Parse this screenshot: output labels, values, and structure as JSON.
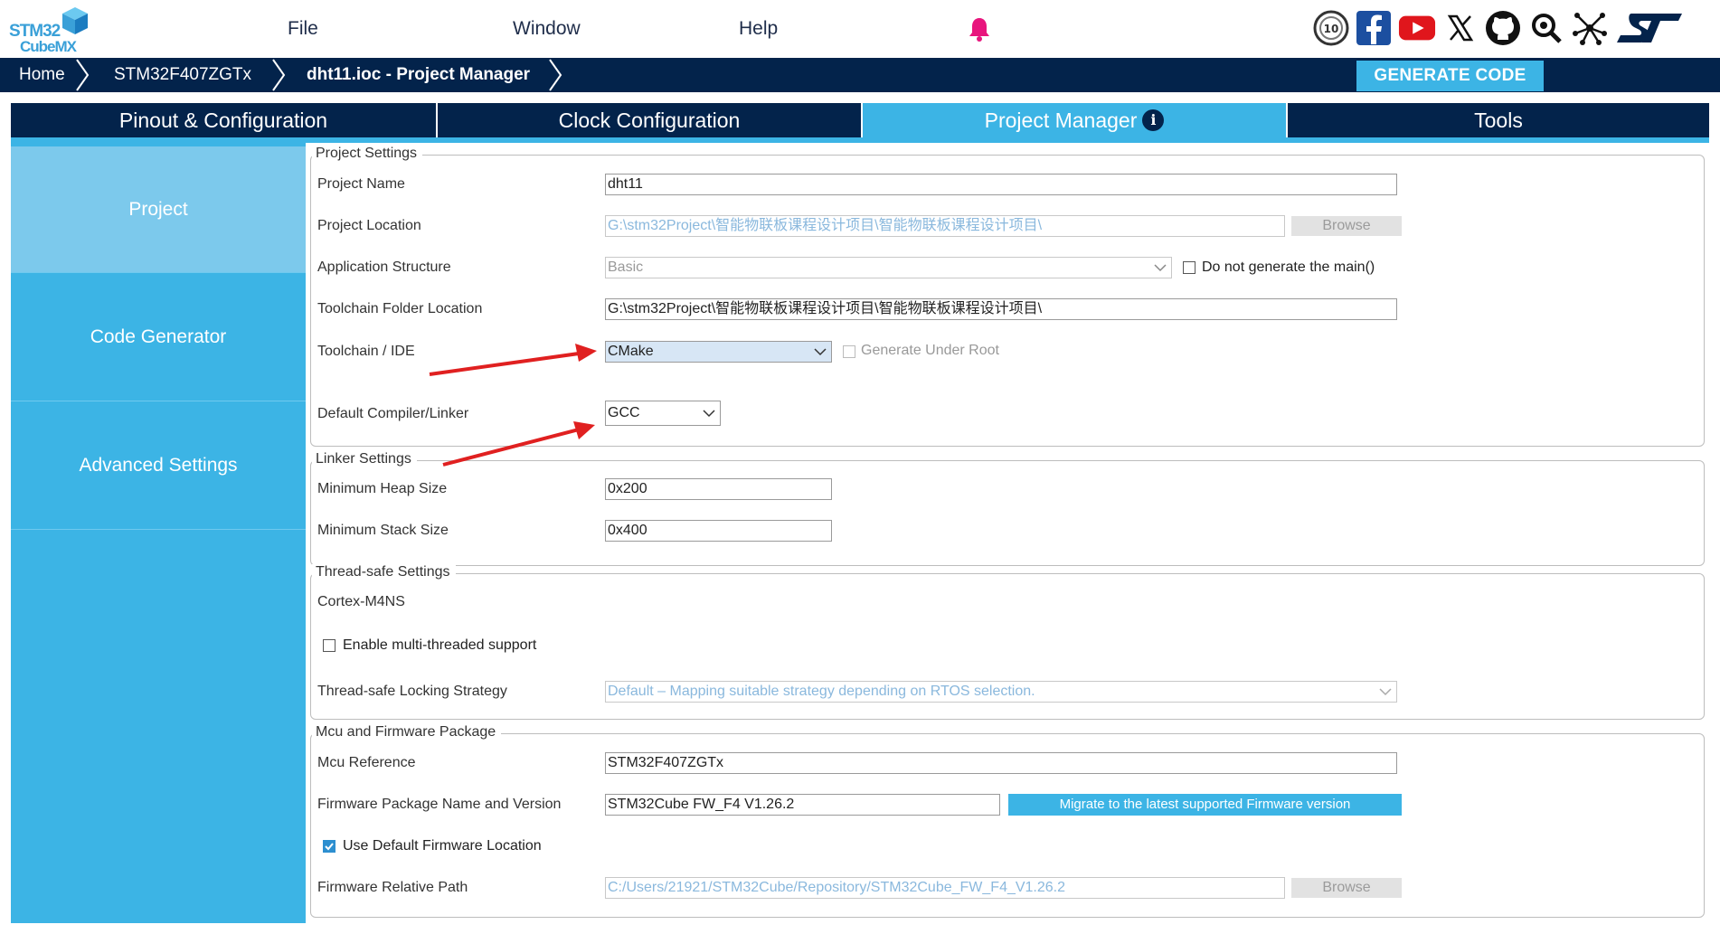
{
  "app": {
    "logo_line1": "STM32",
    "logo_line2": "CubeMX"
  },
  "menu": {
    "file": "File",
    "window": "Window",
    "help": "Help"
  },
  "breadcrumb": {
    "home": "Home",
    "mcu": "STM32F407ZGTx",
    "project": "dht11.ioc - Project Manager"
  },
  "generate_label": "GENERATE CODE",
  "tabs": [
    {
      "label": "Pinout & Configuration"
    },
    {
      "label": "Clock Configuration"
    },
    {
      "label": "Project Manager",
      "active": true
    },
    {
      "label": "Tools"
    }
  ],
  "nav": [
    {
      "label": "Project",
      "active": true
    },
    {
      "label": "Code Generator"
    },
    {
      "label": "Advanced Settings"
    }
  ],
  "project_settings": {
    "legend": "Project Settings",
    "project_name_label": "Project Name",
    "project_name": "dht11",
    "project_location_label": "Project Location",
    "project_location": "G:\\stm32Project\\智能物联板课程设计项目\\智能物联板课程设计项目\\",
    "browse": "Browse",
    "app_structure_label": "Application Structure",
    "app_structure": "Basic",
    "no_main_label": "Do not generate the main()",
    "toolchain_folder_label": "Toolchain Folder Location",
    "toolchain_folder": "G:\\stm32Project\\智能物联板课程设计项目\\智能物联板课程设计项目\\",
    "toolchain_ide_label": "Toolchain / IDE",
    "toolchain_ide": "CMake",
    "gen_under_root_label": "Generate Under Root",
    "compiler_label": "Default Compiler/Linker",
    "compiler": "GCC"
  },
  "linker_settings": {
    "legend": "Linker Settings",
    "heap_label": "Minimum Heap Size",
    "heap": "0x200",
    "stack_label": "Minimum Stack Size",
    "stack": "0x400"
  },
  "thread_safe": {
    "legend": "Thread-safe Settings",
    "core": "Cortex-M4NS",
    "multithread_label": "Enable multi-threaded support",
    "locking_label": "Thread-safe Locking Strategy",
    "locking": "Default – Mapping suitable strategy depending on RTOS selection."
  },
  "mcu_firmware": {
    "legend": "Mcu and Firmware Package",
    "mcu_ref_label": "Mcu Reference",
    "mcu_ref": "STM32F407ZGTx",
    "fw_name_label": "Firmware Package Name and Version",
    "fw_name": "STM32Cube FW_F4 V1.26.2",
    "migrate": "Migrate to the latest supported Firmware version",
    "use_default_label": "Use Default Firmware Location",
    "fw_path_label": "Firmware Relative Path",
    "fw_path": "C:/Users/21921/STM32Cube/Repository/STM32Cube_FW_F4_V1.26.2",
    "browse": "Browse"
  },
  "colors": {
    "navy": "#03234b",
    "accent": "#3cb4e5",
    "nav_active": "#7cc9ec",
    "annotation_red": "#e02020"
  },
  "icons": [
    "bell-icon",
    "anniversary-badge-icon",
    "facebook-icon",
    "youtube-icon",
    "x-icon",
    "github-icon",
    "community-search-icon",
    "network-icon",
    "st-logo-icon",
    "info-icon",
    "chevron-down-icon"
  ]
}
